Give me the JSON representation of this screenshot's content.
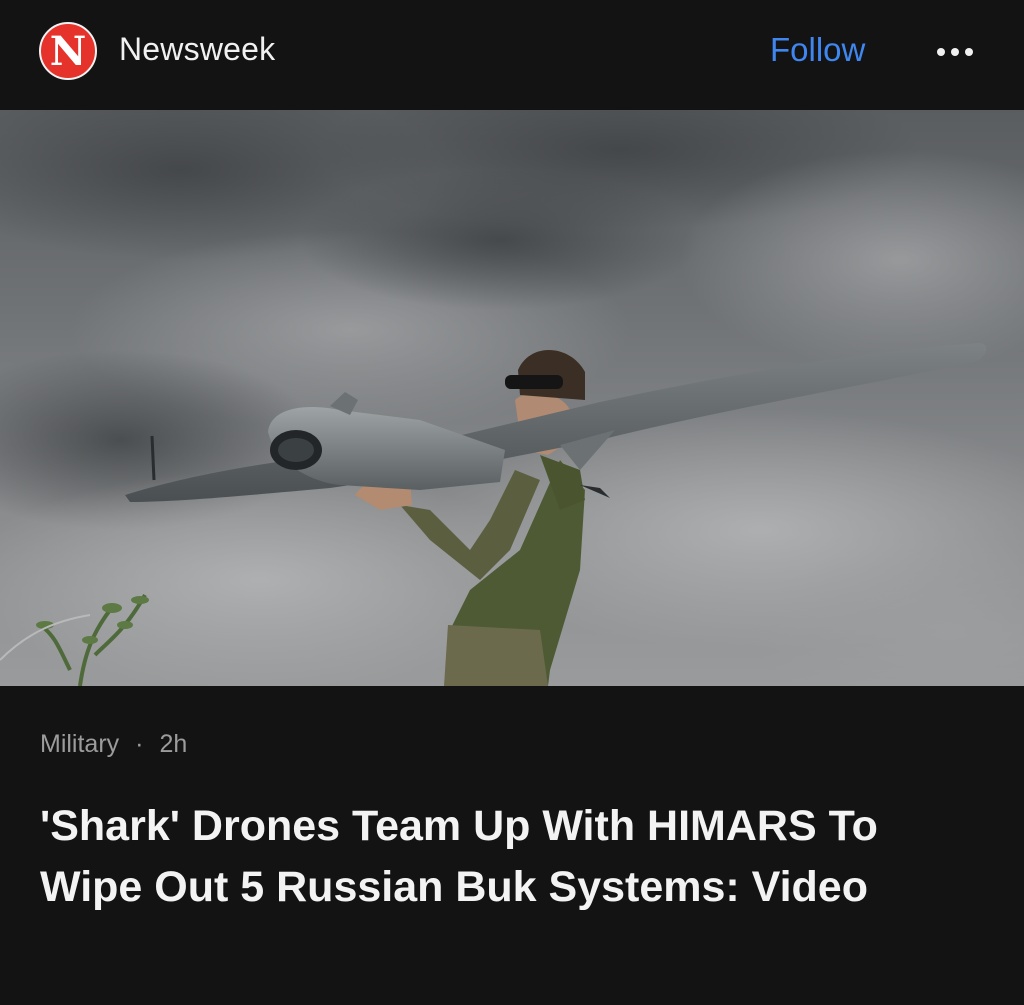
{
  "header": {
    "logo_letter": "N",
    "source_name": "Newsweek",
    "follow_label": "Follow",
    "more_icon": "more-horizontal-icon"
  },
  "hero": {
    "image_alt": "Soldier holding a fixed-wing drone under a cloudy sky"
  },
  "article": {
    "category": "Military",
    "separator": "·",
    "age": "2h",
    "headline": "'Shark' Drones Team Up With HIMARS To Wipe Out 5 Russian Buk Systems: Video"
  },
  "colors": {
    "background": "#131313",
    "accent": "#3f86f0",
    "logo_red": "#e5322b"
  }
}
